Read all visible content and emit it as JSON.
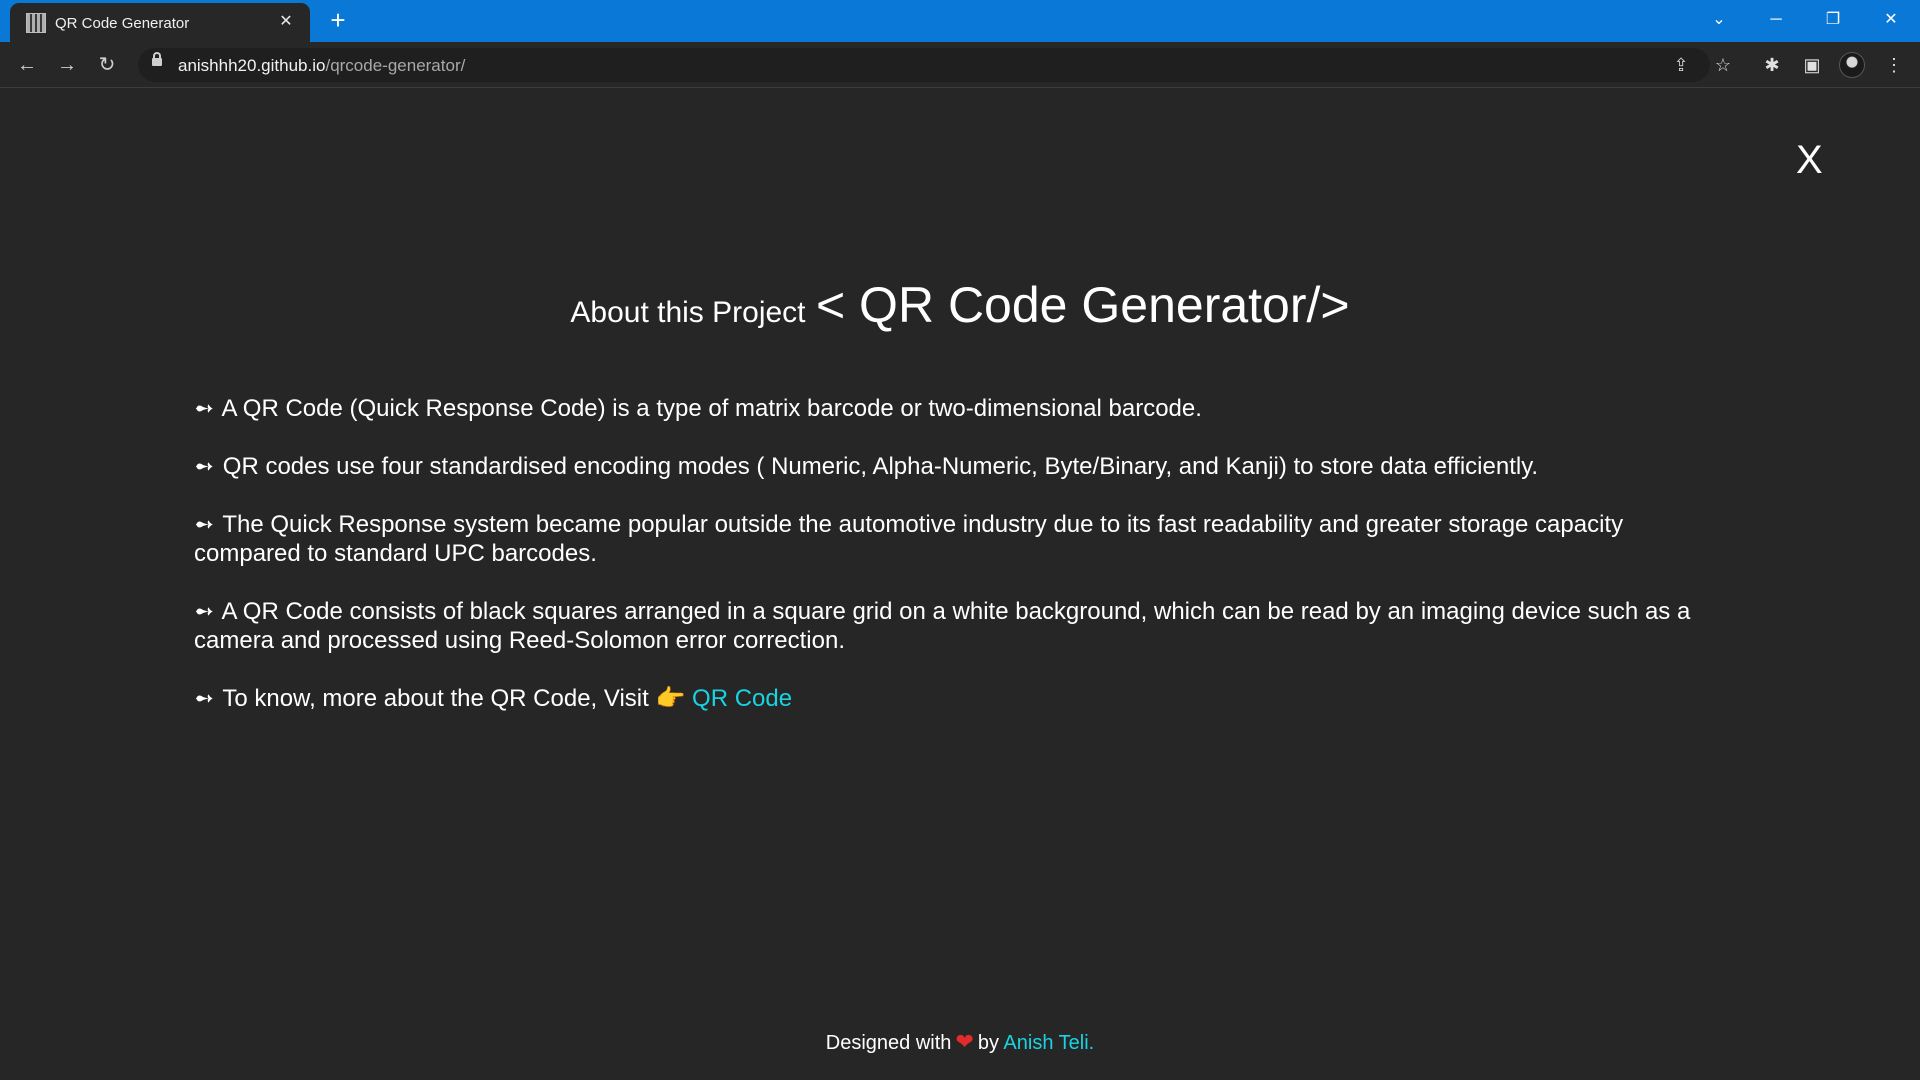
{
  "browser": {
    "tab_title": "QR Code Generator",
    "tab_close": "✕",
    "new_tab": "+",
    "url_host": "anishhh20.github.io",
    "url_path": "/qrcode-generator/",
    "window_controls": {
      "minimize": "─",
      "restore": "❐",
      "close": "✕",
      "tab_search": "⌄"
    },
    "nav": {
      "back": "←",
      "forward": "→",
      "reload": "↻"
    },
    "toolbar_icons": {
      "share": "⇪",
      "bookmark": "☆",
      "extensions": "✱",
      "sidebar": "▣",
      "menu": "⋮"
    }
  },
  "page": {
    "close_label": "X",
    "heading_small": "About this Project",
    "heading_big": "< QR Code Generator/>",
    "bullet": "➻",
    "paragraphs": [
      "A QR Code (Quick Response Code) is a type of matrix barcode or two-dimensional barcode.",
      "QR codes use four standardised encoding modes ( Numeric, Alpha-Numeric, Byte/Binary, and Kanji) to store data efficiently.",
      "The Quick Response system became popular outside the automotive industry due to its fast readability and greater storage capacity compared to standard UPC barcodes.",
      "A QR Code consists of black squares arranged in a square grid on a white background, which can be read by an imaging device such as a camera and processed using Reed-Solomon error correction."
    ],
    "visit_text": "To know, more about the QR Code, Visit",
    "visit_emoji": "👉",
    "visit_link": "QR Code"
  },
  "footer": {
    "prefix": "Designed with",
    "heart": "❤",
    "by": "by",
    "author_link": "Anish Teli."
  },
  "colors": {
    "accent": "#19d3e0",
    "heart": "#e22b2b",
    "background": "#262626",
    "tabbar": "#0a78d7"
  }
}
